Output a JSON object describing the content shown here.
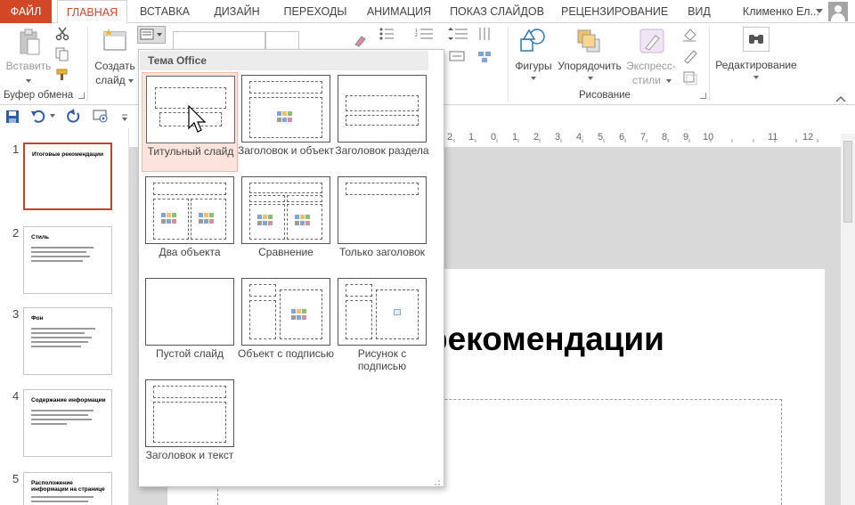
{
  "tabs": {
    "file": "ФАЙЛ",
    "home": "ГЛАВНАЯ",
    "insert": "ВСТАВКА",
    "design": "ДИЗАЙН",
    "transitions": "ПЕРЕХОДЫ",
    "animation": "АНИМАЦИЯ",
    "slideshow": "ПОКАЗ СЛАЙДОВ",
    "review": "РЕЦЕНЗИРОВАНИЕ",
    "view": "ВИД"
  },
  "user": {
    "name": "Клименко Ел..."
  },
  "ribbon": {
    "paste_label": "Вставить",
    "clipboard_group": "Буфер обмена",
    "new_slide_label_1": "Создать",
    "new_slide_label_2": "слайд",
    "shapes_label": "Фигуры",
    "arrange_label": "Упорядочить",
    "quickstyles_label_1": "Экспресс-",
    "quickstyles_label_2": "стили",
    "drawing_group": "Рисование",
    "editing_label": "Редактирование"
  },
  "layouts_menu": {
    "header": "Тема Office",
    "items": [
      {
        "label": "Титульный слайд"
      },
      {
        "label": "Заголовок и объект"
      },
      {
        "label": "Заголовок раздела"
      },
      {
        "label": "Два объекта"
      },
      {
        "label": "Сравнение"
      },
      {
        "label": "Только заголовок"
      },
      {
        "label": "Пустой слайд"
      },
      {
        "label": "Объект с подписью"
      },
      {
        "label": "Рисунок с подписью"
      },
      {
        "label": "Заголовок и текст"
      }
    ]
  },
  "slides": [
    {
      "number": "1",
      "title": "Итоговые рекомендации"
    },
    {
      "number": "2",
      "title": "Стиль"
    },
    {
      "number": "3",
      "title": "Фон"
    },
    {
      "number": "4",
      "title": "Содержание информации"
    },
    {
      "number": "5",
      "title": "Расположение информации на странице"
    }
  ],
  "ruler": [
    "2",
    "1",
    "0",
    "1",
    "2",
    "3",
    "4",
    "5",
    "6",
    "7",
    "8",
    "9",
    "10",
    "11",
    "12"
  ],
  "main_slide": {
    "title_visible": "рекомендации"
  },
  "colors": {
    "accent": "#d24726",
    "hover_fill": "#fce4dc"
  }
}
